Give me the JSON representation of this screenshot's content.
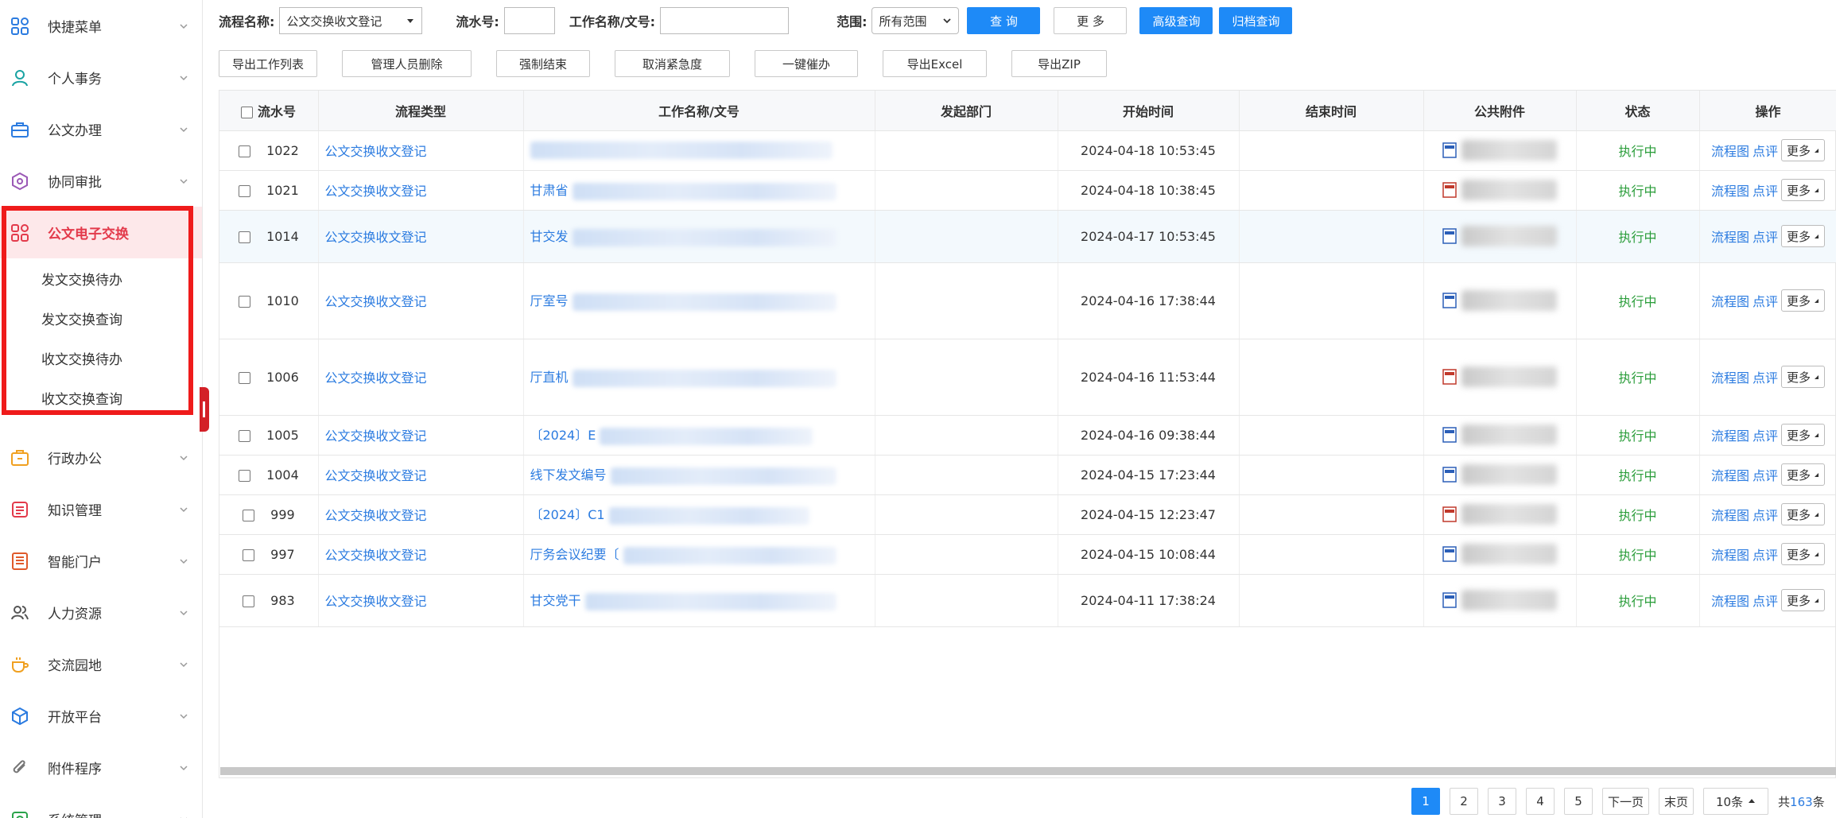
{
  "sidebar": {
    "items": [
      {
        "label": "快捷菜单",
        "icon": "grid-icon",
        "color": "#2b7be0"
      },
      {
        "label": "个人事务",
        "icon": "user-icon",
        "color": "#1aa3a3"
      },
      {
        "label": "公文办理",
        "icon": "briefcase-icon",
        "color": "#2b7be0"
      },
      {
        "label": "协同审批",
        "icon": "approval-icon",
        "color": "#9b59b6"
      },
      {
        "label": "公文电子交换",
        "icon": "grid-icon",
        "color": "#e33a4b",
        "active": true
      },
      {
        "label": "行政办公",
        "icon": "office-icon",
        "color": "#f0a020"
      },
      {
        "label": "知识管理",
        "icon": "book-icon",
        "color": "#e33a4b"
      },
      {
        "label": "智能门户",
        "icon": "portal-icon",
        "color": "#e05a2b"
      },
      {
        "label": "人力资源",
        "icon": "people-icon",
        "color": "#555555"
      },
      {
        "label": "交流园地",
        "icon": "cup-icon",
        "color": "#f0a020"
      },
      {
        "label": "开放平台",
        "icon": "cube-icon",
        "color": "#2b7be0"
      },
      {
        "label": "附件程序",
        "icon": "paperclip-icon",
        "color": "#777777"
      },
      {
        "label": "系统管理",
        "icon": "settings-icon",
        "color": "#2aa34a"
      }
    ],
    "subitems": [
      "发文交换待办",
      "发文交换查询",
      "收文交换待办",
      "收文交换查询"
    ]
  },
  "filters": {
    "flow_name_label": "流程名称:",
    "flow_name_value": "公文交换收文登记",
    "serial_label": "流水号:",
    "work_name_label": "工作名称/文号:",
    "range_label": "范围:",
    "range_value": "所有范围",
    "query": "查 询",
    "more": "更 多",
    "advanced_query": "高级查询",
    "archive_query": "归档查询"
  },
  "actions": [
    "导出工作列表",
    "管理人员删除",
    "强制结束",
    "取消紧急度",
    "一键催办",
    "导出Excel",
    "导出ZIP"
  ],
  "table": {
    "headers": [
      "流水号",
      "流程类型",
      "工作名称/文号",
      "发起部门",
      "开始时间",
      "结束时间",
      "公共附件",
      "状态",
      "操作"
    ],
    "rows": [
      {
        "id": "1022",
        "type": "公文交换收文登记",
        "name": "",
        "start": "2024-04-18 10:53:45",
        "status": "执行中"
      },
      {
        "id": "1021",
        "type": "公文交换收文登记",
        "name": "甘肃省",
        "start": "2024-04-18 10:38:45",
        "status": "执行中"
      },
      {
        "id": "1014",
        "type": "公文交换收文登记",
        "name": "甘交发",
        "start": "2024-04-17 10:53:45",
        "status": "执行中"
      },
      {
        "id": "1010",
        "type": "公文交换收文登记",
        "name": "厅室号",
        "start": "2024-04-16 17:38:44",
        "status": "执行中"
      },
      {
        "id": "1006",
        "type": "公文交换收文登记",
        "name": "厅直机",
        "start": "2024-04-16 11:53:44",
        "status": "执行中"
      },
      {
        "id": "1005",
        "type": "公文交换收文登记",
        "name": "〔2024〕E",
        "start": "2024-04-16 09:38:44",
        "status": "执行中"
      },
      {
        "id": "1004",
        "type": "公文交换收文登记",
        "name": "线下发文编号",
        "start": "2024-04-15 17:23:44",
        "status": "执行中"
      },
      {
        "id": "999",
        "type": "公文交换收文登记",
        "name": "〔2024〕C1",
        "start": "2024-04-15 12:23:47",
        "status": "执行中"
      },
      {
        "id": "997",
        "type": "公文交换收文登记",
        "name": "厅务会议纪要〔",
        "start": "2024-04-15 10:08:44",
        "status": "执行中"
      },
      {
        "id": "983",
        "type": "公文交换收文登记",
        "name": "甘交党干",
        "start": "2024-04-11 17:38:24",
        "status": "执行中"
      }
    ],
    "ops": {
      "flowchart": "流程图",
      "comment": "点评",
      "more": "更多"
    }
  },
  "pager": {
    "pages": [
      "1",
      "2",
      "3",
      "4",
      "5"
    ],
    "next": "下一页",
    "last": "末页",
    "size": "10条",
    "total_prefix": "共",
    "total_count": "163",
    "total_suffix": "条"
  },
  "colors": {
    "primary": "#1e8af7",
    "link": "#2b7be0",
    "status": "#2a9d3a",
    "highlight": "#ef1b1b"
  }
}
